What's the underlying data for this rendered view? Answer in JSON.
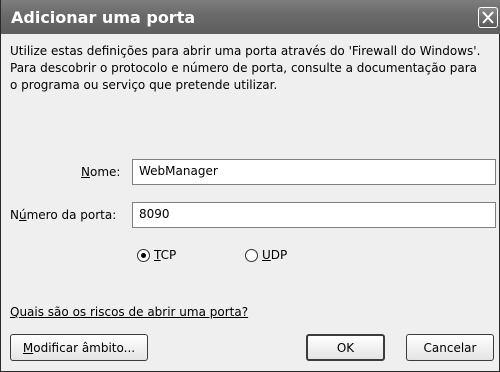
{
  "window": {
    "title": "Adicionar uma porta",
    "close_icon": "close-icon"
  },
  "description": [
    "Utilize estas definições para abrir uma porta através do 'Firewall do Windows'.",
    "Para descobrir o protocolo e número de porta, consulte a documentação para",
    "o programa ou serviço que pretende utilizar."
  ],
  "form": {
    "name": {
      "label_pre": "",
      "label_accel": "N",
      "label_post": "ome:",
      "value": "WebManager"
    },
    "port": {
      "label_pre": "N",
      "label_accel": "ú",
      "label_post": "mero da porta:",
      "value": "8090"
    },
    "protocol": {
      "selected": "TCP",
      "tcp": {
        "accel": "T",
        "rest": "CP"
      },
      "udp": {
        "accel": "U",
        "rest": "DP"
      }
    }
  },
  "link": "Quais são os riscos de abrir uma porta?",
  "buttons": {
    "scope": {
      "accel": "M",
      "rest": "odificar âmbito..."
    },
    "ok": "OK",
    "cancel": "Cancelar"
  }
}
